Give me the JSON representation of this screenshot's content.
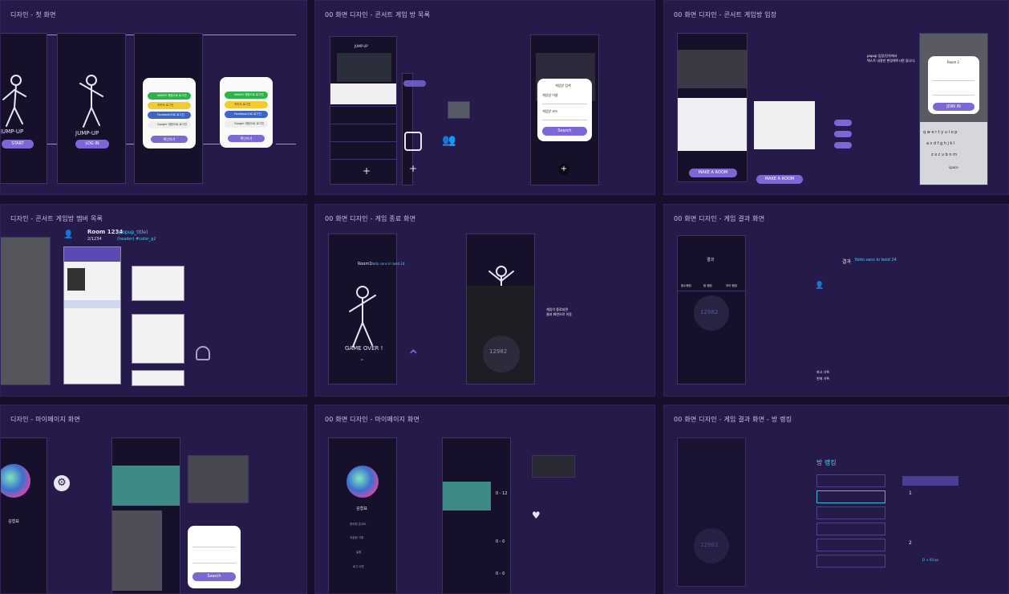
{
  "boards": [
    {
      "title": "디자인 - 첫 화면"
    },
    {
      "title": "00    화면 디자인 - 콘서트 게임 방 목록"
    },
    {
      "title": "00    화면 디자인 - 콘서트 게임방 입장"
    },
    {
      "title": "디자인 - 콘서트 게임방 멤버 목록"
    },
    {
      "title": "00    화면 디자인 - 게임 종료 화면"
    },
    {
      "title": "00    화면 디자인 - 게임 결과 화면"
    },
    {
      "title": "디자인 - 마이페이지 화면"
    },
    {
      "title": "00    화면 디자인 - 마이페이지 화면"
    },
    {
      "title": "00    화면 디자인 - 게임 결과 화면 - 방 랭킹"
    }
  ],
  "first_screen": {
    "start_label": "START",
    "app_name": "JUMP-UP",
    "login_label": "LOG IN",
    "app_name_partial": "JUMP-UP",
    "social": [
      "NAVER 계정으로 로그인",
      "카카오 로그인",
      "Facebook으로 로그인",
      "Google 계정으로 로그인"
    ],
    "confirm": "확인하기"
  },
  "room_list": {
    "header": "JUMP-UP",
    "search_popup_title": "게임방 검색",
    "room_name_label": "게임방 이름",
    "room_code_label": "게임방 코드",
    "search_button": "Search"
  },
  "room_enter": {
    "make_room": "MAKE A ROOM",
    "make_room_2": "MAKE A ROOM",
    "popup_note": "popup 입장/단차에서\n텍스트 내용만 변경해주시면 됩니다.",
    "room_title": "Room 1",
    "join_label": "JOIN IN",
    "keyboard_rows": [
      "q w e r t y u i o p",
      "a s d f g h j k l",
      "z x c v b n m"
    ],
    "space": "space"
  },
  "members": {
    "room_title": "Room 1234",
    "popup_title_note": "(popup_title)",
    "count": "2/1234",
    "header_note": "(header) #color_g2"
  },
  "game_over": {
    "room_label": "Room1",
    "font_note": "Noto sans kr bold 24",
    "game_over_text": "GAME OVER !",
    "score": "12982",
    "note": "게임이 종료되면\n결과 화면으로 이동"
  },
  "game_result": {
    "title": "결과",
    "font_note": "Noto sans kr bold 24",
    "tabs": [
      "점수랭킹",
      "팀 랭킹",
      "모아 랭킹"
    ],
    "score": "12982",
    "labels": [
      "최고 기록",
      "현재 기록"
    ]
  },
  "mypage": {
    "name": "김형표",
    "menu": [
      "참여한 콘서트",
      "저장한 기록",
      "설정",
      "로그 아웃"
    ],
    "search_button": "Search",
    "scores": [
      "0 - 12",
      "0 - 0",
      "0 - 0"
    ]
  },
  "ranking": {
    "title": "방 랭킹",
    "score": "12982",
    "entries": [
      "1",
      "2"
    ],
    "note": "D + 93 px"
  },
  "colors": {
    "bg": "#170f2c",
    "board": "#261a4a",
    "accent": "#7d67d4",
    "annotation": "#4fd0f0"
  }
}
